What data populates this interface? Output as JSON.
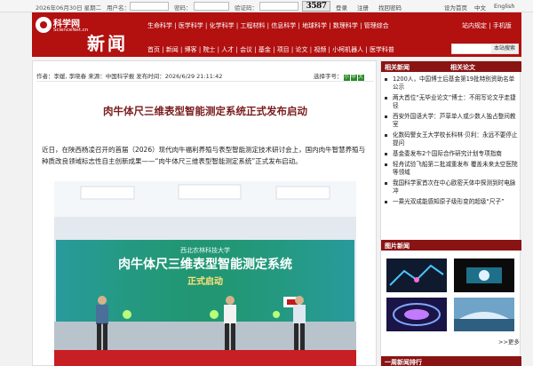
{
  "topbar": {
    "date": "2026年06月30日 星期二",
    "username_label": "用户名：",
    "password_label": "密码：",
    "captcha_label": "验证码：",
    "captcha_text": "3587",
    "login": "登录",
    "register": "注册",
    "forgot_password": "找回密码",
    "home": "设为首页",
    "lang_cn": "中文",
    "lang_en": "English"
  },
  "header": {
    "logo_cn": "科学网",
    "logo_en": "ScienceNet.cn",
    "section_title": "新闻",
    "nav_row1": [
      "生命科学",
      "医学科学",
      "化学科学",
      "工程材料",
      "信息科学",
      "地球科学",
      "数理科学",
      "管理综合"
    ],
    "nav_row2": [
      "首页",
      "新闻",
      "博客",
      "院士",
      "人才",
      "会议",
      "基金",
      "项目",
      "论文",
      "视频",
      "小柯机器人",
      "医学科普"
    ],
    "site_map": "站内规定",
    "mobile": "手机版",
    "search_button": "本站搜索"
  },
  "article": {
    "meta": "作者：李媛, 李晓春 来源：中国科学报 发布时间：2026/6/29 21:11:42",
    "font_size_label": "选择字号：",
    "font_sizes": [
      "小",
      "中",
      "大"
    ],
    "headline": "肉牛体尺三维表型智能测定系统正式发布启动",
    "lead": "近日，在陕西杨凌召开的首届（2026）现代肉牛福利养殖与表型智能测定技术研讨会上，国内肉牛智慧养殖与种质改良领域标志性自主创新成果——“肉牛体尺三维表型智能测定系统”正式发布启动。",
    "banner_org": "西北农林科技大学",
    "banner_line1": "肉牛体尺三维表型智能测定系统",
    "banner_line2": "正式启动"
  },
  "sidebar": {
    "tab_news": "相关新闻",
    "tab_papers": "相关论文",
    "items": [
      "1200人，中国博士后基金第19批特别资助名单公示",
      "两大首位“无毕业论文”博士：不用写论文乎走捷径",
      "西安外国语大学：芦草单人或少数人独占整间教室",
      "化数码警女王大学校长科林·贝利：永远不要停止提问",
      "基金委发布2个国际合作研究计划专项指南",
      "轻舟试验飞船第二批减重发布 覆盖未来太空医院等领域",
      "我国科学家首次在中心欧密天体中探测到时电脉冲",
      "一乘光双成能感知原子级形变的超级“尺子”"
    ],
    "pics_header": "图片新闻",
    "more": ">>更多",
    "rank_header": "一周新闻排行"
  },
  "colors": {
    "brand_red": "#b31010",
    "sidebar_header": "#8a1414",
    "headline": "#7a1d1d",
    "fontsize_button": "#2d8a2d"
  }
}
